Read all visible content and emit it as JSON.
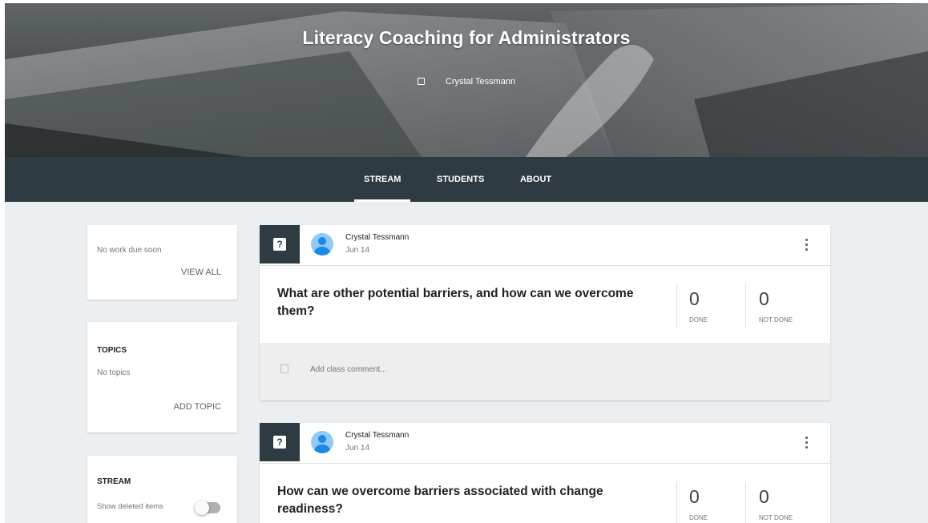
{
  "header": {
    "class_title": "Literacy Coaching for Administrators",
    "teacher": "Crystal Tessmann"
  },
  "tabs": [
    {
      "label": "STREAM",
      "active": true
    },
    {
      "label": "STUDENTS",
      "active": false
    },
    {
      "label": "ABOUT",
      "active": false
    }
  ],
  "sidebar": {
    "upcoming": {
      "text": "No work due soon",
      "view_all": "VIEW ALL"
    },
    "topics": {
      "heading": "TOPICS",
      "text": "No topics",
      "add_topic": "ADD TOPIC"
    },
    "stream": {
      "heading": "STREAM",
      "show_deleted": "Show deleted items",
      "show_deleted_on": false
    }
  },
  "posts": [
    {
      "author": "Crystal Tessmann",
      "date": "Jun 14",
      "question": "What are other potential barriers, and how can we overcome them?",
      "done_count": "0",
      "done_label": "DONE",
      "not_done_count": "0",
      "not_done_label": "NOT DONE",
      "comment_placeholder": "Add class comment..."
    },
    {
      "author": "Crystal Tessmann",
      "date": "Jun 14",
      "question": "How can we overcome barriers associated with change readiness?",
      "done_count": "0",
      "done_label": "DONE",
      "not_done_count": "0",
      "not_done_label": "NOT DONE"
    }
  ],
  "colors": {
    "tab_bar": "#2f3b43",
    "page_background": "#eceff1",
    "question_badge": "#2f3b43",
    "avatar": "#1e88e5"
  }
}
